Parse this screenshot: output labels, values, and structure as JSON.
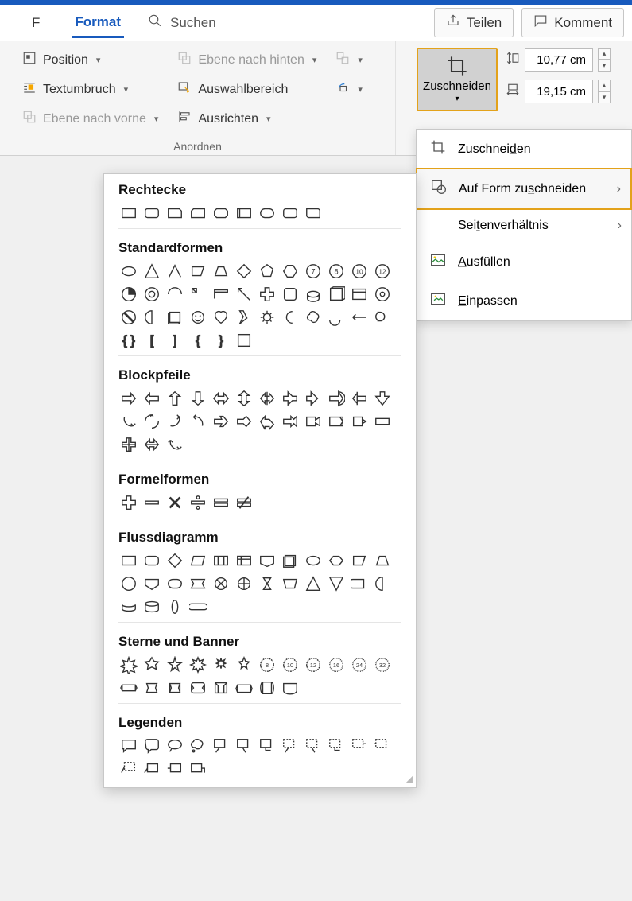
{
  "tabs": {
    "format": "Format",
    "search": "Suchen"
  },
  "top": {
    "teilen": "Teilen",
    "kommentare": "Komment"
  },
  "ribbon": {
    "position": "Position",
    "textumbruch": "Textumbruch",
    "ebene_vorne": "Ebene nach vorne",
    "ebene_hinten": "Ebene nach hinten",
    "auswahlbereich": "Auswahlbereich",
    "ausrichten": "Ausrichten",
    "group_label": "Anordnen",
    "zuschneiden": "Zuschneiden"
  },
  "size": {
    "height": "10,77 cm",
    "width": "19,15 cm"
  },
  "crop_menu": {
    "zuschneiden": "Zuschneiden",
    "auf_form": "Auf Form zuschneiden",
    "seitenverh": "Seitenverhältnis",
    "ausfuellen": "Ausfüllen",
    "einpassen": "Einpassen"
  },
  "shape_categories": {
    "rechtecke": "Rechtecke",
    "standardformen": "Standardformen",
    "blockpfeile": "Blockpfeile",
    "formelformen": "Formelformen",
    "flussdiagramm": "Flussdiagramm",
    "sterne": "Sterne und Banner",
    "legenden": "Legenden"
  },
  "shape_counts": {
    "rechtecke": 9,
    "standardformen": 42,
    "blockpfeile": 27,
    "formelformen": 6,
    "flussdiagramm": 28,
    "sterne": 20,
    "legenden": 16
  }
}
